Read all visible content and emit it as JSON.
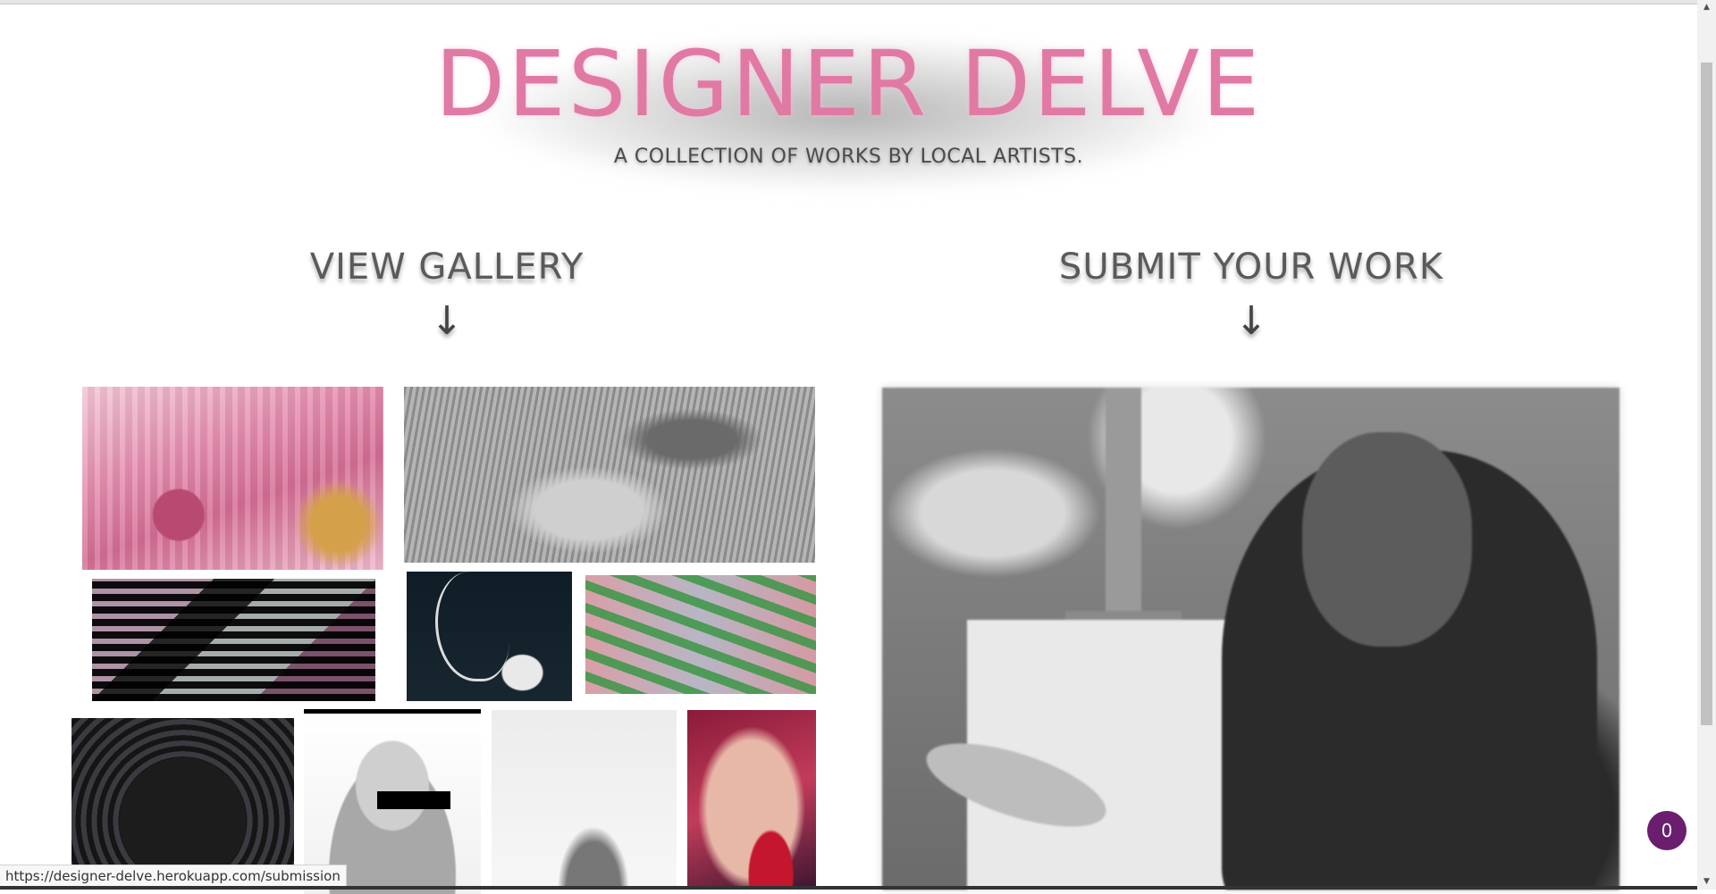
{
  "header": {
    "title": "DESIGNER DELVE",
    "tagline": "A COLLECTION OF WORKS BY LOCAL ARTISTS."
  },
  "gallery": {
    "heading": "VIEW GALLERY",
    "arrow": "↓"
  },
  "submit": {
    "heading": "SUBMIT YOUR WORK",
    "arrow": "↓"
  },
  "cart": {
    "count": "0"
  },
  "status_bar": {
    "url": "https://designer-delve.herokuapp.com/submission"
  },
  "scrollbar": {
    "up_icon": "▲",
    "down_icon": "▼"
  },
  "colors": {
    "title_pink": "#e07aa5",
    "badge_purple": "#6b1d6e"
  }
}
